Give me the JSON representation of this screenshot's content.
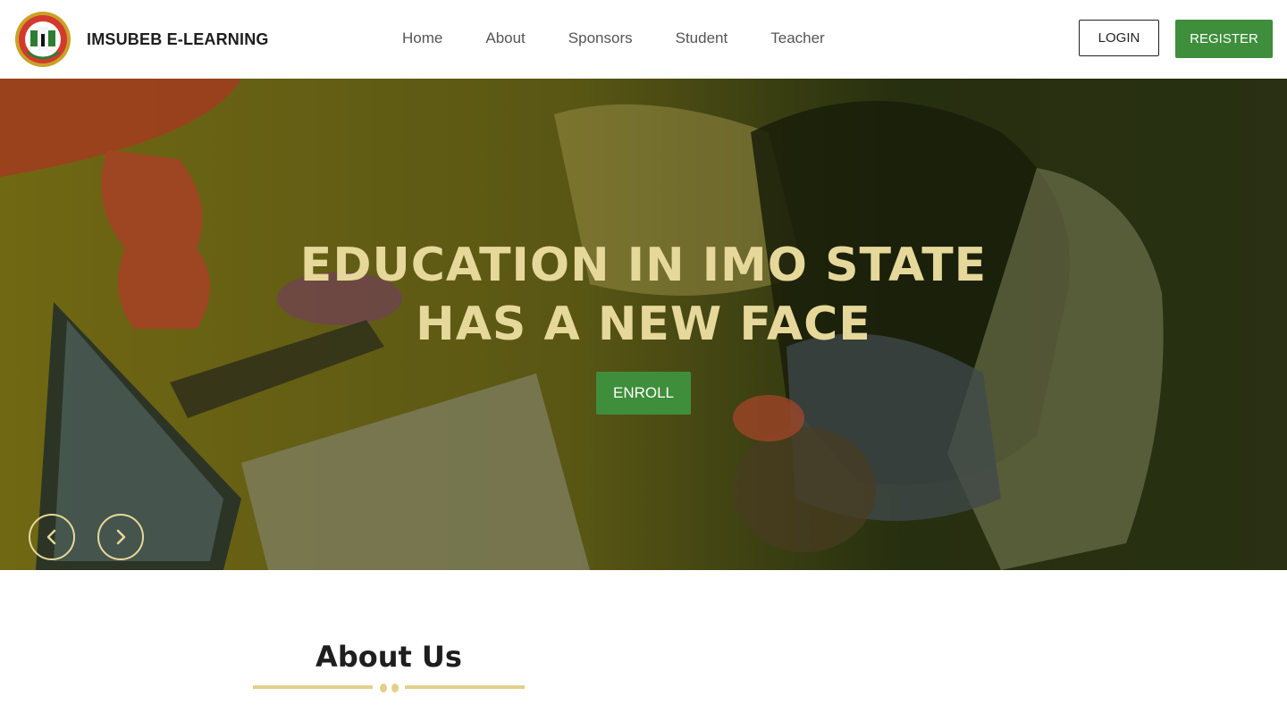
{
  "header": {
    "brand_name": "IMSUBEB E-LEARNING",
    "nav": [
      "Home",
      "About",
      "Sponsors",
      "Student",
      "Teacher"
    ],
    "login_label": "LOGIN",
    "register_label": "REGISTER"
  },
  "hero": {
    "title_line1": "EDUCATION IN IMO STATE",
    "title_line2": "HAS A NEW FACE",
    "enroll_label": "ENROLL",
    "prev_icon": "chevron-left-icon",
    "next_icon": "chevron-right-icon"
  },
  "about": {
    "title": "About Us"
  },
  "colors": {
    "accent_green": "#3e8e3b",
    "gold": "#e6d89a",
    "overlay": "#5a5a10"
  }
}
